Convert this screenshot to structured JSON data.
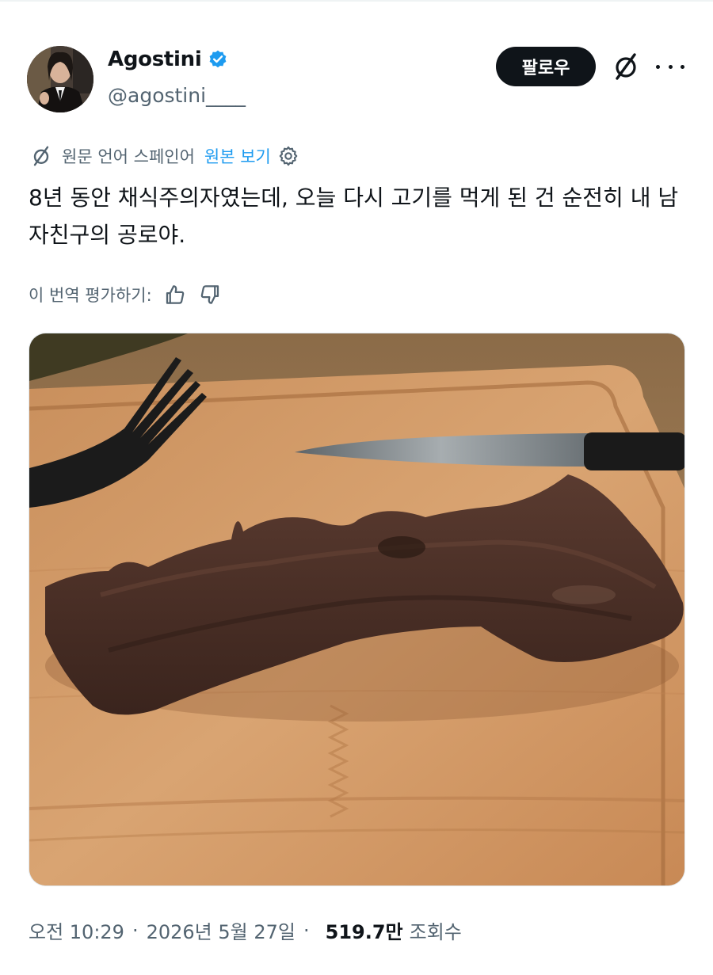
{
  "author": {
    "display_name": "Agostini",
    "handle": "@agostini____",
    "verified": true,
    "badge_color": "#1d9bf0"
  },
  "header": {
    "follow_label": "팔로우",
    "grok_icon": "grok-icon",
    "more_icon": "more-icon"
  },
  "translation": {
    "source_text": "원문 언어 스페인어",
    "show_original": "원본 보기",
    "settings_icon": "gear-icon"
  },
  "tweet": {
    "text": "8년 동안 채식주의자였는데, 오늘 다시 고기를 먹게 된 건 순전히 내 남자친구의 공로야."
  },
  "rating": {
    "label": "이 번역 평가하기:",
    "like_icon": "thumbs-up-icon",
    "dislike_icon": "thumbs-down-icon"
  },
  "media": {
    "description_icon": "photo"
  },
  "meta": {
    "time": "오전 10:29",
    "separator": "·",
    "date": "2026년 5월 27일",
    "views_count": "519.7만",
    "views_label": "조회수"
  },
  "colors": {
    "text": "#0f1419",
    "secondary": "#536471",
    "link": "#1d9bf0"
  }
}
